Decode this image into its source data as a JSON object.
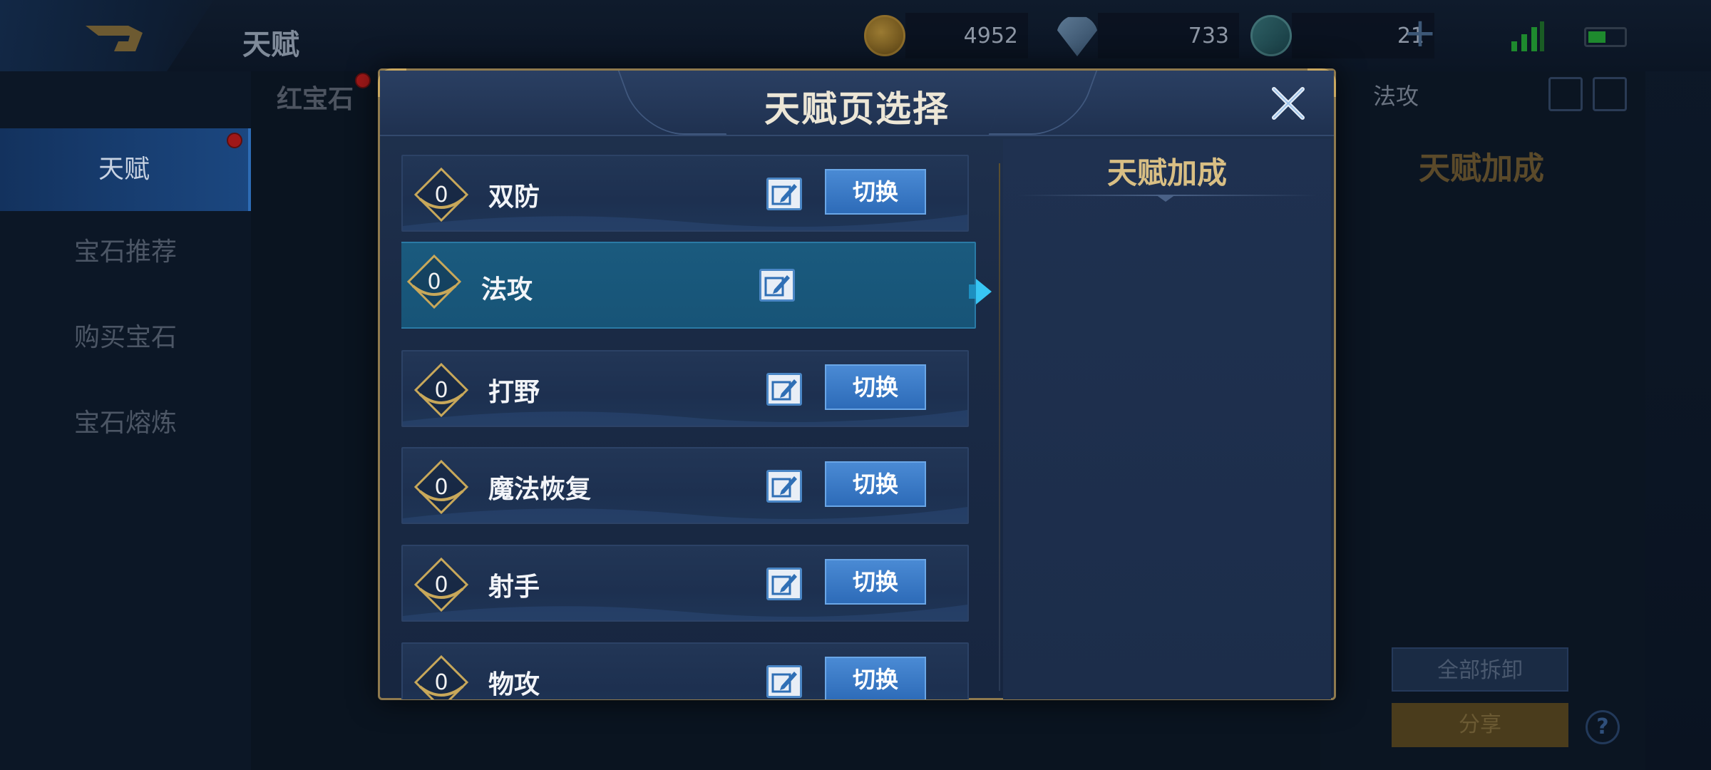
{
  "header": {
    "title": "天赋",
    "resources": [
      {
        "icon": "gold-coin-icon",
        "value": "4952"
      },
      {
        "icon": "diamond-icon",
        "value": "733"
      },
      {
        "icon": "ticket-icon",
        "value": "21"
      }
    ]
  },
  "background": {
    "gem_tab": "红宝石",
    "current_page_tab": "法攻",
    "sidebar": [
      {
        "label": "天赋",
        "active": true
      },
      {
        "label": "宝石推荐",
        "active": false
      },
      {
        "label": "购买宝石",
        "active": false
      },
      {
        "label": "宝石熔炼",
        "active": false
      }
    ],
    "bonus_title": "天赋加成",
    "remove_all": "全部拆卸",
    "share": "分享",
    "help": "?"
  },
  "modal": {
    "title": "天赋页选择",
    "bonus_title": "天赋加成",
    "switch_label": "切换",
    "rows": [
      {
        "level": "0",
        "name": "双防",
        "active": false
      },
      {
        "level": "0",
        "name": "法攻",
        "active": true
      },
      {
        "level": "0",
        "name": "打野",
        "active": false
      },
      {
        "level": "0",
        "name": "魔法恢复",
        "active": false
      },
      {
        "level": "0",
        "name": "射手",
        "active": false
      },
      {
        "level": "0",
        "name": "物攻",
        "active": false
      }
    ]
  },
  "colors": {
    "accent_gold": "#d9bf84",
    "switch_button": "#2d6bb8",
    "active_row": "#175477"
  }
}
